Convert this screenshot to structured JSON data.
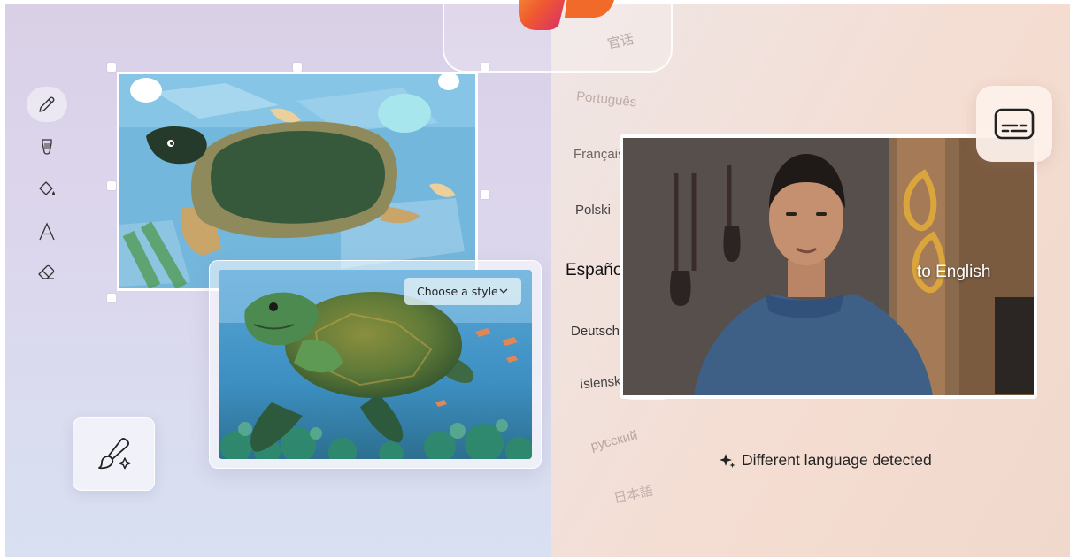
{
  "editor": {
    "tools": [
      {
        "name": "pencil-icon",
        "active": true
      },
      {
        "name": "brush-tip-icon",
        "active": false
      },
      {
        "name": "paint-bucket-icon",
        "active": false
      },
      {
        "name": "text-icon",
        "active": false
      },
      {
        "name": "eraser-icon",
        "active": false
      }
    ],
    "style_dropdown": {
      "label": "Choose a style"
    },
    "brush_button_icon": "paintbrush-sparkle-icon"
  },
  "translator": {
    "languages": [
      {
        "label": "官话",
        "state": "faded"
      },
      {
        "label": "Português",
        "state": "faded"
      },
      {
        "label": "Français",
        "state": "dim"
      },
      {
        "label": "Polski",
        "state": "dim"
      },
      {
        "label": "Español",
        "state": "selected"
      },
      {
        "label": "Deutsch",
        "state": "dim"
      },
      {
        "label": "íslenska",
        "state": "dim"
      },
      {
        "label": "русский",
        "state": "faded"
      },
      {
        "label": "日本語",
        "state": "faded"
      }
    ],
    "target": "to English",
    "detected": "Different language detected",
    "captions_icon": "subtitles-icon"
  },
  "colors": {
    "left_bg": "#d9d2e8",
    "right_bg": "#f3e0d6",
    "accent_orange": "#f06a28",
    "accent_pink": "#e5357a"
  }
}
